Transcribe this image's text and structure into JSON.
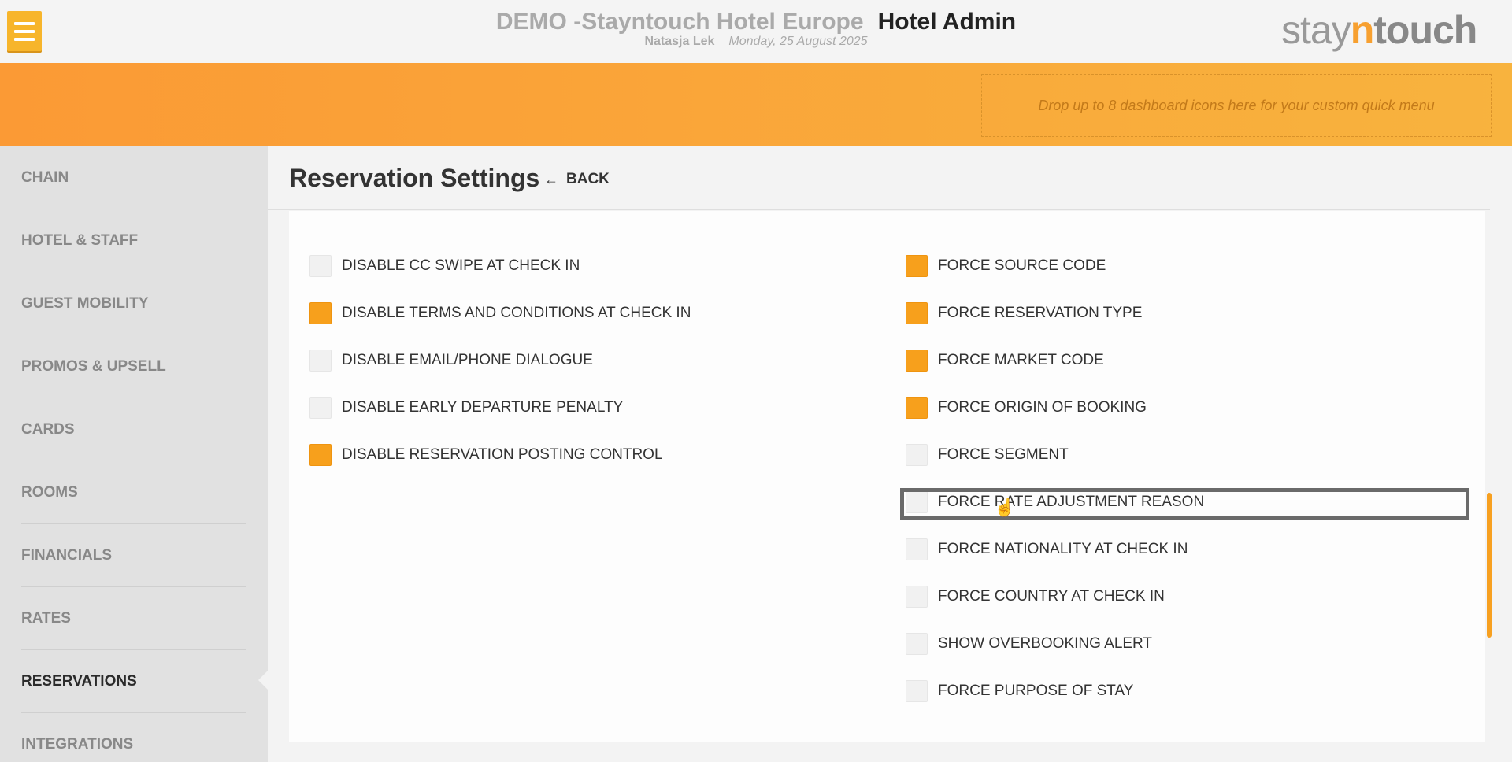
{
  "header": {
    "hotel_name": "DEMO -Stayntouch Hotel Europe",
    "app_name": "Hotel Admin",
    "user": "Natasja Lek",
    "date": "Monday, 25 August 2025",
    "logo": {
      "pre": "stay",
      "n": "n",
      "post": "touch"
    }
  },
  "quick_menu": {
    "placeholder": "Drop up to 8 dashboard icons here for your custom quick menu"
  },
  "sidebar": {
    "items": [
      {
        "label": "CHAIN"
      },
      {
        "label": "HOTEL & STAFF"
      },
      {
        "label": "GUEST MOBILITY"
      },
      {
        "label": "PROMOS & UPSELL"
      },
      {
        "label": "CARDS"
      },
      {
        "label": "ROOMS"
      },
      {
        "label": "FINANCIALS"
      },
      {
        "label": "RATES"
      },
      {
        "label": "RESERVATIONS",
        "active": true
      },
      {
        "label": "INTEGRATIONS"
      }
    ]
  },
  "page": {
    "title": "Reservation Settings",
    "back_label": "BACK"
  },
  "settings": {
    "left": [
      {
        "label": "DISABLE CC SWIPE AT CHECK IN",
        "checked": false
      },
      {
        "label": "DISABLE TERMS AND CONDITIONS AT CHECK IN",
        "checked": true
      },
      {
        "label": "DISABLE EMAIL/PHONE DIALOGUE",
        "checked": false
      },
      {
        "label": "DISABLE EARLY DEPARTURE PENALTY",
        "checked": false
      },
      {
        "label": "DISABLE RESERVATION POSTING CONTROL",
        "checked": true
      }
    ],
    "right": [
      {
        "label": "FORCE SOURCE CODE",
        "checked": true
      },
      {
        "label": "FORCE RESERVATION TYPE",
        "checked": true
      },
      {
        "label": "FORCE MARKET CODE",
        "checked": true
      },
      {
        "label": "FORCE ORIGIN OF BOOKING",
        "checked": true
      },
      {
        "label": "FORCE SEGMENT",
        "checked": false
      },
      {
        "label": "FORCE RATE ADJUSTMENT REASON",
        "checked": false,
        "focused": true
      },
      {
        "label": "FORCE NATIONALITY AT CHECK IN",
        "checked": false
      },
      {
        "label": "FORCE COUNTRY AT CHECK IN",
        "checked": false
      },
      {
        "label": "SHOW OVERBOOKING ALERT",
        "checked": false
      },
      {
        "label": "FORCE PURPOSE OF STAY",
        "checked": false
      }
    ]
  },
  "colors": {
    "accent": "#f7a01c",
    "band_start": "#fb9a35",
    "band_end": "#f8b33e"
  }
}
